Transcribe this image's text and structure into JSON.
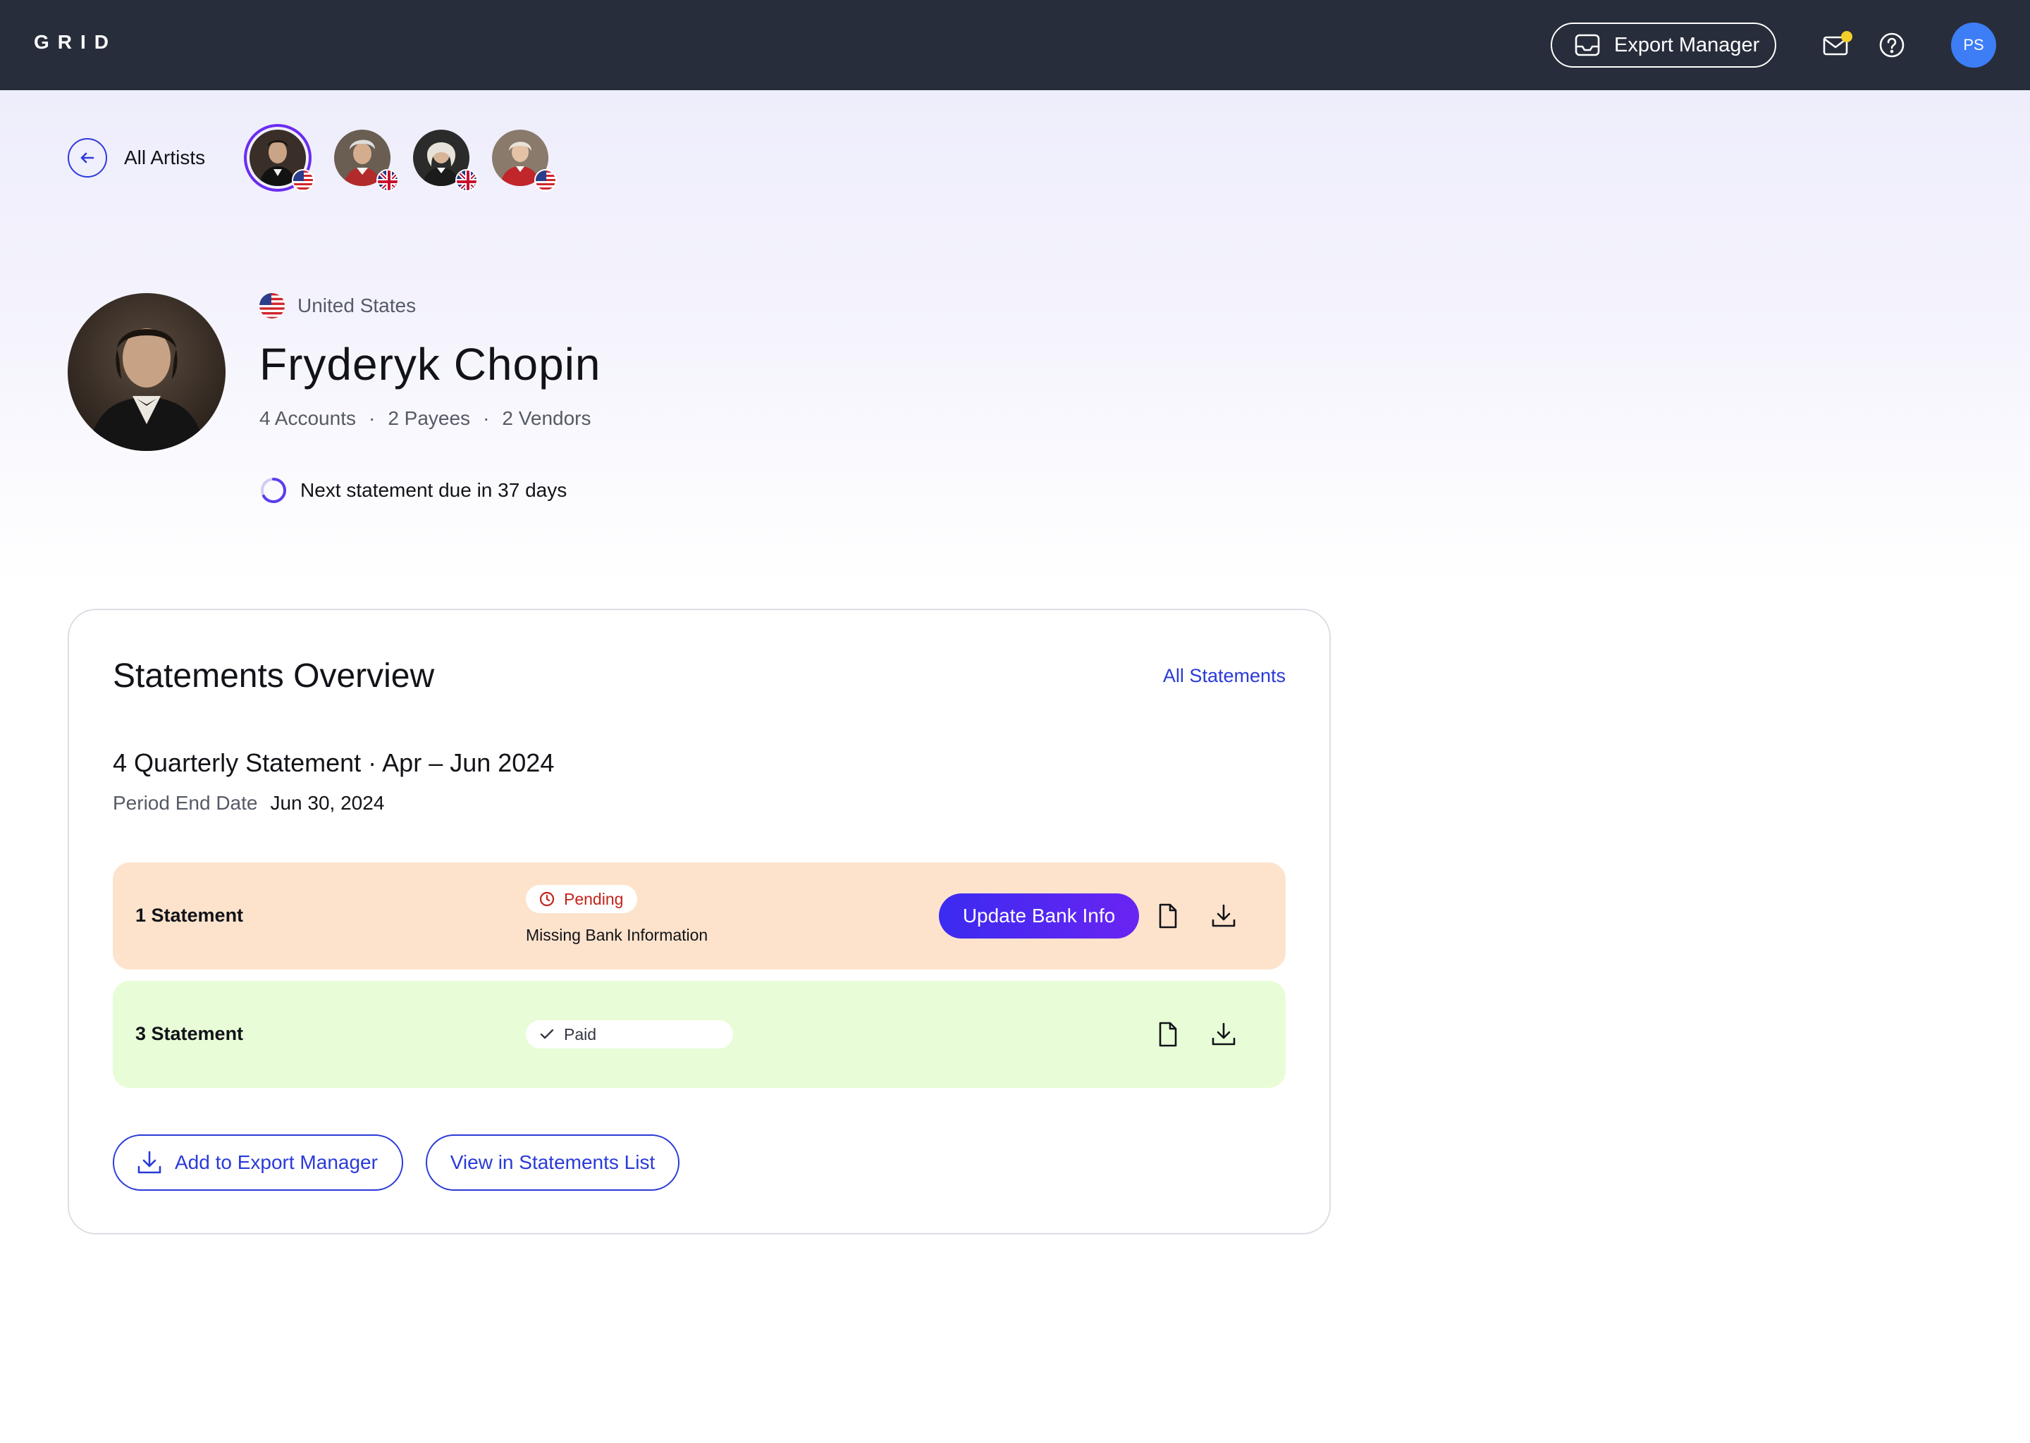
{
  "header": {
    "logo": "GRID",
    "export_manager_label": "Export Manager",
    "user_initials": "PS",
    "icons": [
      "inbox-icon",
      "mail-icon",
      "help-icon"
    ]
  },
  "nav": {
    "back_label": "All Artists",
    "artists": [
      {
        "name": "artist-1",
        "flag": "us-flag",
        "active": true
      },
      {
        "name": "artist-2",
        "flag": "uk-flag",
        "active": false
      },
      {
        "name": "artist-3",
        "flag": "uk-flag",
        "active": false
      },
      {
        "name": "artist-4",
        "flag": "us-flag",
        "active": false
      }
    ]
  },
  "profile": {
    "country": "United States",
    "name": "Fryderyk Chopin",
    "accounts": "4 Accounts",
    "payees": "2 Payees",
    "vendors": "2 Vendors",
    "separator": "·",
    "due_text": "Next statement due in 37 days"
  },
  "overview": {
    "title": "Statements Overview",
    "all_statements_link": "All Statements",
    "period_title": "4 Quarterly Statement · Apr – Jun 2024",
    "period_end_label": "Period End Date",
    "period_end_value": "Jun 30, 2024",
    "rows": [
      {
        "label": "1 Statement",
        "status": "Pending",
        "status_color": "#c3231b",
        "sub": "Missing Bank Information",
        "action": "Update Bank Info",
        "bg": "#fde3cc"
      },
      {
        "label": "3 Statement",
        "status": "Paid",
        "status_color": "#333744",
        "bg": "#e8fdd7"
      }
    ],
    "add_export_label": "Add to Export Manager",
    "view_list_label": "View in Statements List"
  },
  "colors": {
    "topbar": "#272d3a",
    "accent": "#2a3ad8",
    "gradient_button": "#3b2bf0",
    "avatar": "#3d7df5"
  }
}
